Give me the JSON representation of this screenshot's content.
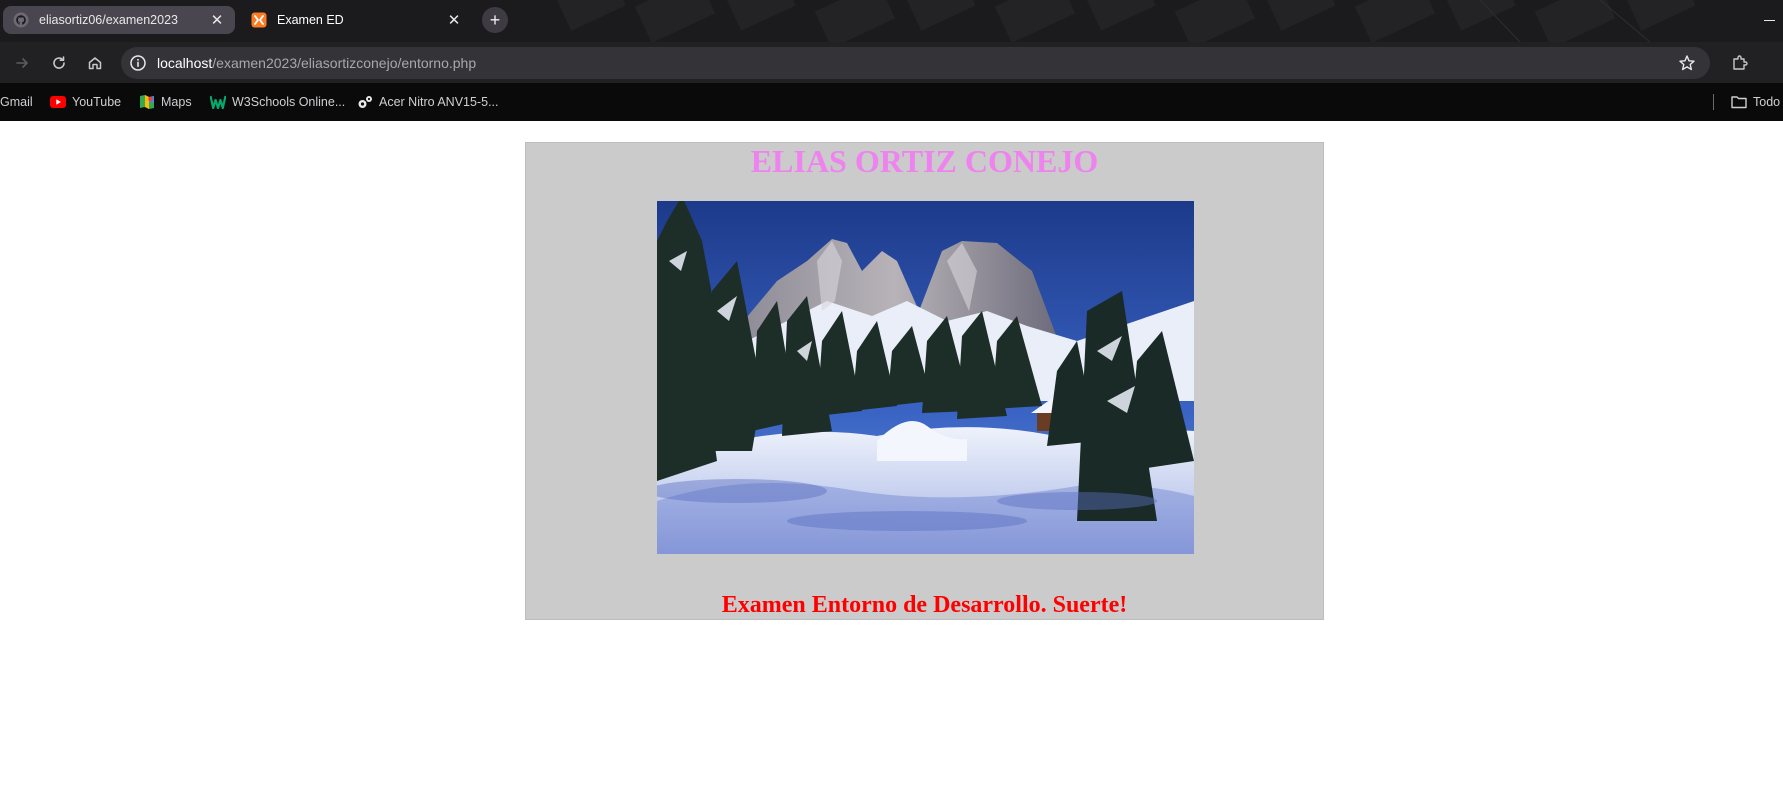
{
  "browser": {
    "tabs": [
      {
        "title": "eliasortiz06/examen2023",
        "icon": "github-icon",
        "active": false
      },
      {
        "title": "Examen ED",
        "icon": "xampp-icon",
        "active": true
      }
    ],
    "new_tab_symbol": "+",
    "close_symbol": "✕",
    "address": {
      "host": "localhost",
      "path": "/examen2023/eliasortizconejo/entorno.php"
    },
    "bookmarks": [
      {
        "label": "Gmail",
        "icon": "gmail-icon"
      },
      {
        "label": "YouTube",
        "icon": "youtube-icon"
      },
      {
        "label": "Maps",
        "icon": "maps-icon"
      },
      {
        "label": "W3Schools Online...",
        "icon": "w3schools-icon"
      },
      {
        "label": "Acer Nitro ANV15-5...",
        "icon": "acer-icon"
      },
      {
        "label": "Todo",
        "icon": "folder-icon"
      }
    ]
  },
  "page": {
    "heading": "ELIAS ORTIZ CONEJO",
    "image_subject": "snowy mountain landscape with pine trees and a cabin",
    "message": "Examen Entorno de Desarrollo. Suerte!",
    "colors": {
      "heading": "#ee82ee",
      "message": "#ff0000",
      "panel_background": "#cbcbcb"
    }
  }
}
